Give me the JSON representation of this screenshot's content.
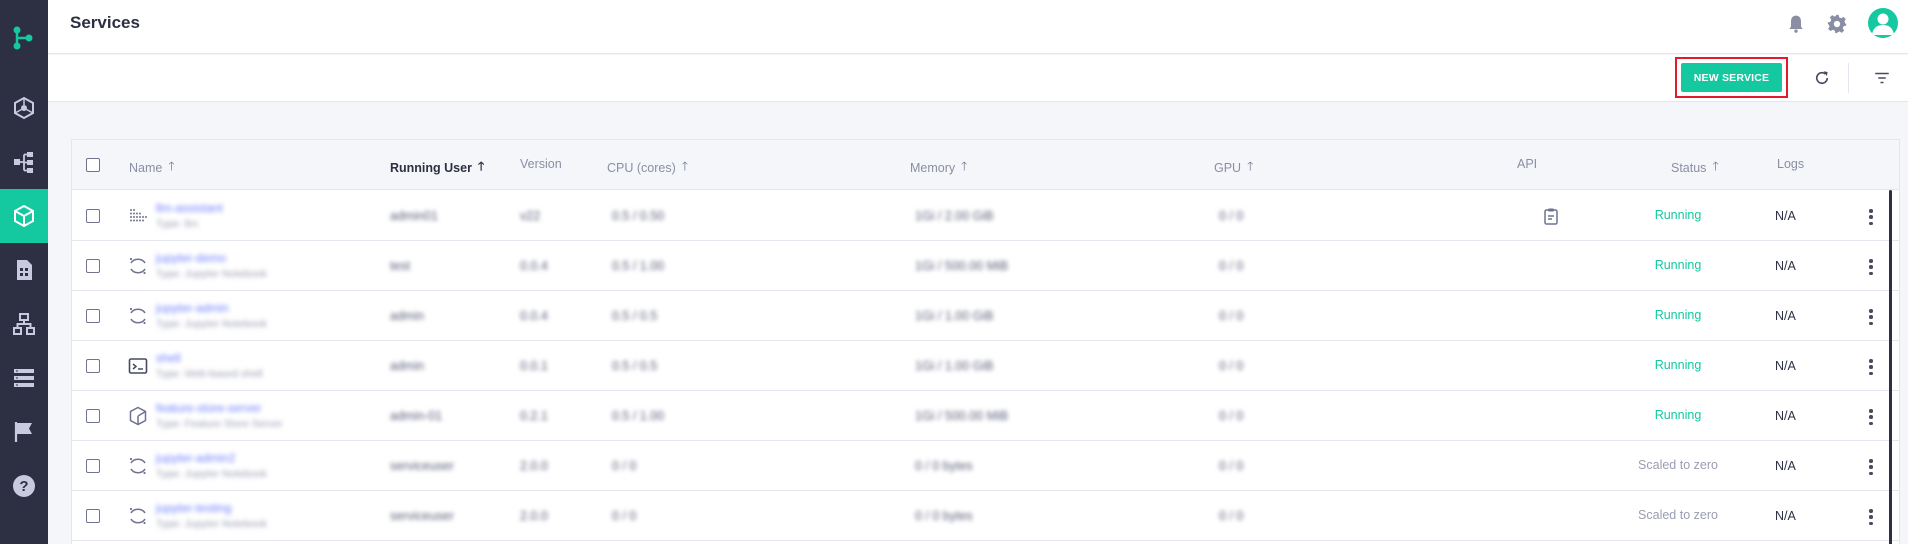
{
  "app": {
    "colors": {
      "sidebar": "#2d2f43",
      "accent": "#14c8a0",
      "highlight": "#e01b2b",
      "link": "#6c7dff"
    }
  },
  "sidebar": {
    "items": [
      {
        "icon": "hexagon-network-icon",
        "active": false
      },
      {
        "icon": "pipeline-icon",
        "active": false
      },
      {
        "icon": "cube-icon",
        "active": true
      },
      {
        "icon": "file-data-icon",
        "active": false
      },
      {
        "icon": "network-tree-icon",
        "active": false
      },
      {
        "icon": "list-icon",
        "active": false
      },
      {
        "icon": "flag-icon",
        "active": false
      },
      {
        "icon": "help-icon",
        "active": false
      }
    ]
  },
  "header": {
    "title": "Services",
    "icons": [
      "bell-icon",
      "gear-icon",
      "user-avatar-icon"
    ]
  },
  "toolbar": {
    "new_service_label": "NEW SERVICE",
    "icons": [
      "refresh-icon",
      "filter-icon"
    ]
  },
  "table": {
    "columns": {
      "name": "Name",
      "running_user": "Running User",
      "version": "Version",
      "cpu": "CPU (cores)",
      "memory": "Memory",
      "gpu": "GPU",
      "api": "API",
      "status": "Status",
      "logs": "Logs"
    },
    "rows": [
      {
        "icon": "dots-triangle-icon",
        "name": "llm-assistant",
        "type": "Type: llm",
        "user": "admin01",
        "version": "v22",
        "cpu": "0.5 / 0.50",
        "memory": "1Gi / 2.00 GiB",
        "gpu": "0 / 0",
        "api": true,
        "status": "Running",
        "status_kind": "running",
        "logs": "N/A"
      },
      {
        "icon": "jupyter-icon",
        "name": "jupyter-demo",
        "type": "Type: Jupyter Notebook",
        "user": "test",
        "version": "0.0.4",
        "cpu": "0.5 / 1.00",
        "memory": "1Gi / 500.00 MiB",
        "gpu": "0 / 0",
        "api": false,
        "status": "Running",
        "status_kind": "running",
        "logs": "N/A"
      },
      {
        "icon": "jupyter-icon",
        "name": "jupyter-admin",
        "type": "Type: Jupyter Notebook",
        "user": "admin",
        "version": "0.0.4",
        "cpu": "0.5 / 0.5",
        "memory": "1Gi / 1.00 GiB",
        "gpu": "0 / 0",
        "api": false,
        "status": "Running",
        "status_kind": "running",
        "logs": "N/A"
      },
      {
        "icon": "terminal-icon",
        "name": "shell",
        "type": "Type: Web-based shell",
        "user": "admin",
        "version": "0.0.1",
        "cpu": "0.5 / 0.5",
        "memory": "1Gi / 1.00 GiB",
        "gpu": "0 / 0",
        "api": false,
        "status": "Running",
        "status_kind": "running",
        "logs": "N/A"
      },
      {
        "icon": "cube-outline-icon",
        "name": "feature-store-server",
        "type": "Type: Feature Store Server",
        "user": "admin-01",
        "version": "0.2.1",
        "cpu": "0.5 / 1.00",
        "memory": "1Gi / 500.00 MiB",
        "gpu": "0 / 0",
        "api": false,
        "status": "Running",
        "status_kind": "running",
        "logs": "N/A"
      },
      {
        "icon": "jupyter-icon",
        "name": "jupyter-admin2",
        "type": "Type: Jupyter Notebook",
        "user": "serviceuser",
        "version": "2.0.0",
        "cpu": "0 / 0",
        "memory": "0 / 0 bytes",
        "gpu": "0 / 0",
        "api": false,
        "status": "Scaled to zero",
        "status_kind": "scaled",
        "logs": "N/A"
      },
      {
        "icon": "jupyter-icon",
        "name": "jupyter-testing",
        "type": "Type: Jupyter Notebook",
        "user": "serviceuser",
        "version": "2.0.0",
        "cpu": "0 / 0",
        "memory": "0 / 0 bytes",
        "gpu": "0 / 0",
        "api": false,
        "status": "Scaled to zero",
        "status_kind": "scaled",
        "logs": "N/A"
      }
    ]
  }
}
